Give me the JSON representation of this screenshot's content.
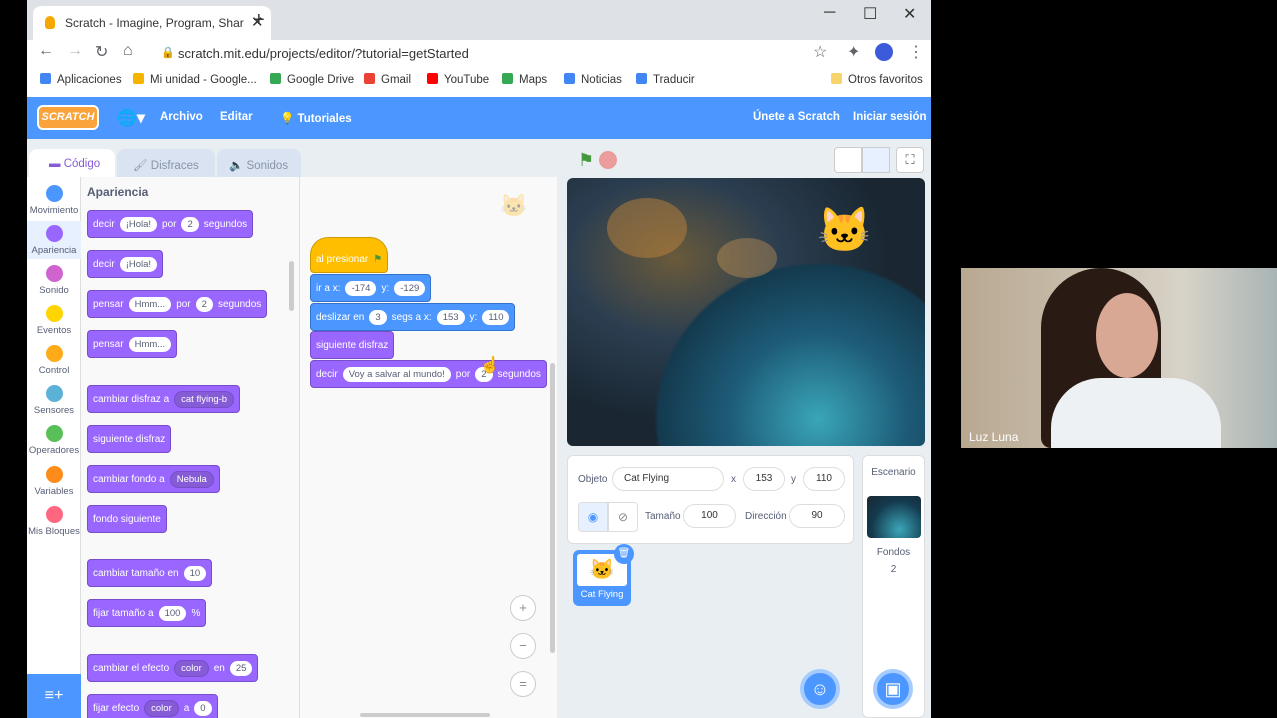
{
  "browser": {
    "tab_title": "Scratch - Imagine, Program, Shar",
    "tab_close": "✕",
    "new_tab": "+",
    "url": "scratch.mit.edu/projects/editor/?tutorial=getStarted",
    "window": {
      "minimize": "─",
      "maximize": "☐",
      "close": "✕"
    },
    "bookmarks": [
      {
        "label": "Aplicaciones",
        "color": "#4285f4"
      },
      {
        "label": "Mi unidad - Google...",
        "color": "#f4b400"
      },
      {
        "label": "Google Drive",
        "color": "#34a853"
      },
      {
        "label": "Gmail",
        "color": "#ea4335"
      },
      {
        "label": "YouTube",
        "color": "#ff0000"
      },
      {
        "label": "Maps",
        "color": "#34a853"
      },
      {
        "label": "Noticias",
        "color": "#4285f4"
      },
      {
        "label": "Traducir",
        "color": "#4285f4"
      }
    ],
    "other_favorites": "Otros favoritos"
  },
  "menu": {
    "logo": "SCRATCH",
    "file": "Archivo",
    "edit": "Editar",
    "tutorials": "Tutoriales",
    "join": "Únete a Scratch",
    "signin": "Iniciar sesión"
  },
  "tabs": {
    "code": "Código",
    "costumes": "Disfraces",
    "sounds": "Sonidos"
  },
  "categories": [
    {
      "label": "Movimiento",
      "color": "#4c97ff"
    },
    {
      "label": "Apariencia",
      "color": "#9966ff"
    },
    {
      "label": "Sonido",
      "color": "#cf63cf"
    },
    {
      "label": "Eventos",
      "color": "#ffd500"
    },
    {
      "label": "Control",
      "color": "#ffab19"
    },
    {
      "label": "Sensores",
      "color": "#5cb1d6"
    },
    {
      "label": "Operadores",
      "color": "#59c059"
    },
    {
      "label": "Variables",
      "color": "#ff8c1a"
    },
    {
      "label": "Mis Bloques",
      "color": "#ff6680"
    }
  ],
  "palette": {
    "heading": "Apariencia",
    "say_for": {
      "w1": "decir",
      "v1": "¡Hola!",
      "w2": "por",
      "v2": "2",
      "w3": "segundos"
    },
    "say": {
      "w1": "decir",
      "v1": "¡Hola!"
    },
    "think_for": {
      "w1": "pensar",
      "v1": "Hmm...",
      "w2": "por",
      "v2": "2",
      "w3": "segundos"
    },
    "think": {
      "w1": "pensar",
      "v1": "Hmm..."
    },
    "switch_costume": {
      "w1": "cambiar disfraz a",
      "v1": "cat flying-b"
    },
    "next_costume": "siguiente disfraz",
    "switch_backdrop": {
      "w1": "cambiar fondo a",
      "v1": "Nebula"
    },
    "next_backdrop": "fondo siguiente",
    "change_size": {
      "w1": "cambiar tamaño en",
      "v1": "10"
    },
    "set_size": {
      "w1": "fijar tamaño a",
      "v1": "100",
      "w2": "%"
    },
    "change_effect": {
      "w1": "cambiar el efecto",
      "v1": "color",
      "w2": "en",
      "v2": "25"
    },
    "set_effect": {
      "w1": "fijar efecto",
      "v1": "color",
      "w2": "a",
      "v2": "0"
    }
  },
  "script": {
    "hat": "al presionar",
    "goto": {
      "w1": "ir a x:",
      "x": "-174",
      "w2": "y:",
      "y": "-129"
    },
    "glide": {
      "w1": "deslizar en",
      "t": "3",
      "w2": "segs a x:",
      "x": "153",
      "w3": "y:",
      "y": "110"
    },
    "next_costume": "siguiente disfraz",
    "say": {
      "w1": "decir",
      "v1": "Voy a salvar al mundo!",
      "w2": "por",
      "v2": "2",
      "w3": "segundos"
    },
    "zoom_in": "+",
    "zoom_out": "−",
    "zoom_reset": "="
  },
  "sprite_info": {
    "object_label": "Objeto",
    "name": "Cat Flying",
    "x_label": "x",
    "x": "153",
    "y_label": "y",
    "y": "110",
    "size_label": "Tamaño",
    "size": "100",
    "direction_label": "Dirección",
    "direction": "90"
  },
  "sprite_thumb": "Cat Flying",
  "stage_pane": {
    "title": "Escenario",
    "backdrops_label": "Fondos",
    "backdrops_count": "2"
  },
  "webcam": {
    "name": "Luz Luna"
  }
}
